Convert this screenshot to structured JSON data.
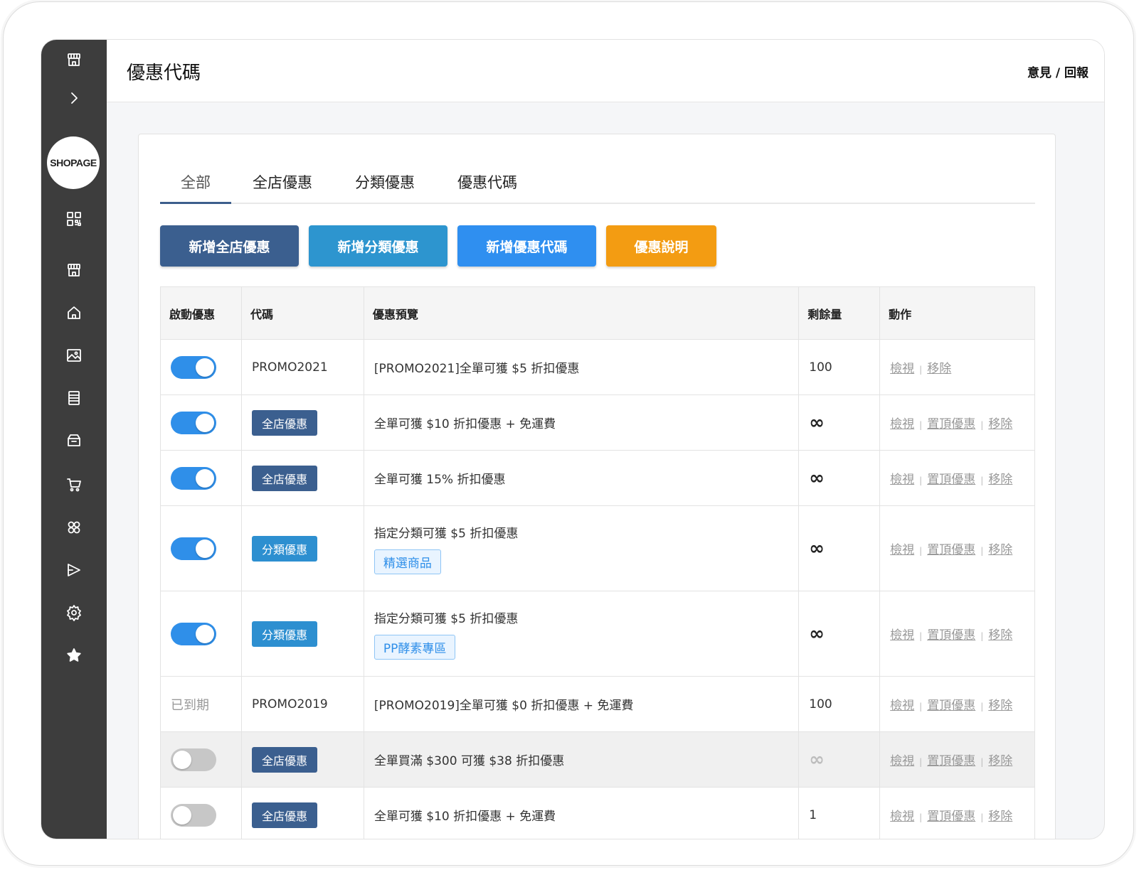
{
  "brand": "SHOPAGE",
  "header": {
    "title": "優惠代碼",
    "feedback": "意見 / 回報"
  },
  "tabs": [
    {
      "label": "全部",
      "active": true
    },
    {
      "label": "全店優惠"
    },
    {
      "label": "分類優惠"
    },
    {
      "label": "優惠代碼"
    }
  ],
  "buttons": {
    "add_store": {
      "label": "新增全店優惠",
      "color": "#3b5f8f"
    },
    "add_category": {
      "label": "新增分類優惠",
      "color": "#2d95cf"
    },
    "add_code": {
      "label": "新增優惠代碼",
      "color": "#2f8ff0"
    },
    "explain": {
      "label": "優惠說明",
      "color": "#f39c12"
    }
  },
  "table": {
    "headers": [
      "啟動優惠",
      "代碼",
      "優惠預覽",
      "剩餘量",
      "動作"
    ],
    "actions": {
      "view": "檢視",
      "pin": "置頂優惠",
      "remove": "移除",
      "sep": "|"
    },
    "rows": [
      {
        "status": "on",
        "code": "PROMO2021",
        "preview": "[PROMO2021]全單可獲 $5 折扣優惠",
        "remaining": "100"
      },
      {
        "status": "on",
        "badge": "全店優惠",
        "preview": "全單可獲 $10 折扣優惠 + 免運費",
        "remaining": "∞"
      },
      {
        "status": "on",
        "badge": "全店優惠",
        "preview": "全單可獲 15% 折扣優惠",
        "remaining": "∞"
      },
      {
        "status": "on",
        "badge": "分類優惠",
        "preview": "指定分類可獲 $5 折扣優惠",
        "tag": "精選商品",
        "remaining": "∞"
      },
      {
        "status": "on",
        "badge": "分類優惠",
        "preview": "指定分類可獲 $5 折扣優惠",
        "tag": "PP酵素專區",
        "remaining": "∞"
      },
      {
        "status": "已到期",
        "code": "PROMO2019",
        "preview": "[PROMO2019]全單可獲 $0 折扣優惠 + 免運費",
        "remaining": "100"
      },
      {
        "status": "off",
        "badge": "全店優惠",
        "preview": "全單買滿 $300 可獲 $38 折扣優惠",
        "remaining": "∞"
      },
      {
        "status": "off",
        "badge": "全店優惠",
        "preview": "全單可獲 $10 折扣優惠 + 免運費",
        "remaining": "1"
      }
    ]
  },
  "colors": {
    "sidebar": "#3d3d3d",
    "toggle_on": "#2f8fe9",
    "badge_store": "#3b5f8f",
    "badge_category": "#2d8fd0"
  },
  "sidebar_icons": [
    "storefront-icon",
    "chevron-right-icon",
    "qr-code-icon",
    "store-icon",
    "home-icon",
    "image-icon",
    "document-icon",
    "inbox-icon",
    "cart-icon",
    "members-icon",
    "megaphone-icon",
    "gear-icon",
    "star-icon"
  ]
}
